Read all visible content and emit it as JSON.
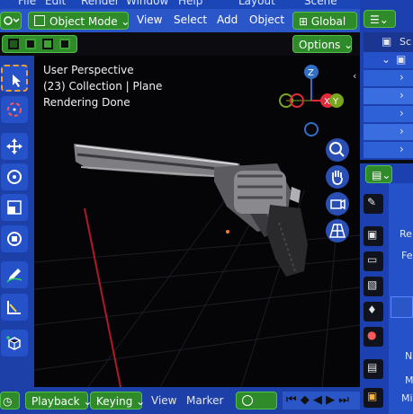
{
  "topbar": {
    "items": [
      "File",
      "Edit",
      "Render",
      "Window",
      "Help"
    ],
    "workspace_tab": "Layout",
    "scene_name": "Scene"
  },
  "header": {
    "mode_label": "Object Mode",
    "menu": {
      "view": "View",
      "select": "Select",
      "add": "Add",
      "object": "Object"
    },
    "orientation_label": "Global",
    "options_label": "Options"
  },
  "viewport": {
    "perspective": "User Perspective",
    "collection": "(23) Collection | Plane",
    "status": "Rendering Done",
    "gizmo": {
      "z": "Z",
      "y": "Y",
      "x": "X"
    }
  },
  "timeline": {
    "playback_label": "Playback",
    "keying_label": "Keying",
    "view_label": "View",
    "marker_label": "Marker"
  },
  "outliner": {
    "row1": "Sc",
    "row2": ""
  },
  "properties": {
    "texts": [
      "Re",
      "Fe",
      "N",
      "M",
      "Mi"
    ]
  },
  "colors": {
    "header_blue": "#2a56c8",
    "accent_green": "#2f8a2a",
    "axis_red": "#e02a3a",
    "axis_green": "#7aa61f",
    "axis_blue": "#2f6fc4"
  }
}
